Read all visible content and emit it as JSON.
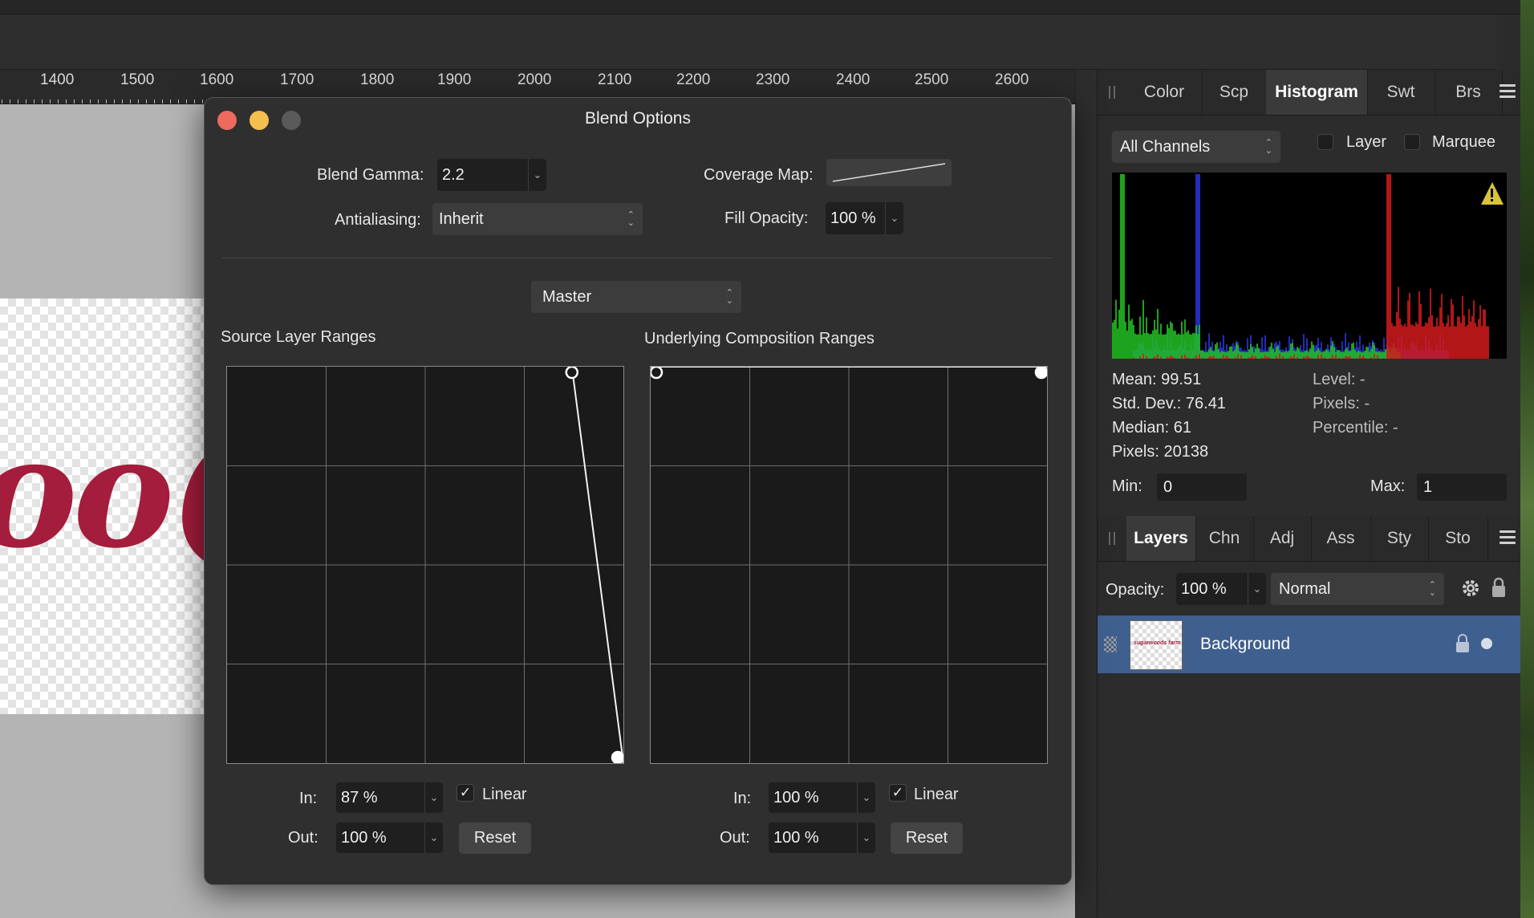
{
  "ruler": {
    "labels": [
      "1400",
      "1500",
      "1600",
      "1700",
      "1800",
      "1900",
      "2000",
      "2100",
      "2200",
      "2300",
      "2400",
      "2500",
      "2600"
    ]
  },
  "canvas": {
    "doc_text": "oo("
  },
  "dialog": {
    "title": "Blend Options",
    "blend_gamma_label": "Blend Gamma:",
    "blend_gamma_value": "2.2",
    "coverage_map_label": "Coverage Map:",
    "antialiasing_label": "Antialiasing:",
    "antialiasing_value": "Inherit",
    "fill_opacity_label": "Fill Opacity:",
    "fill_opacity_value": "100 %",
    "channel_value": "Master",
    "source": {
      "title": "Source Layer Ranges",
      "in_label": "In:",
      "in_value": "87 %",
      "out_label": "Out:",
      "out_value": "100 %",
      "linear_label": "Linear",
      "linear_checked": true,
      "reset_label": "Reset",
      "curve_points": [
        [
          0.87,
          1.0
        ],
        [
          1.0,
          0.0
        ]
      ]
    },
    "underlying": {
      "title": "Underlying Composition Ranges",
      "in_label": "In:",
      "in_value": "100 %",
      "out_label": "Out:",
      "out_value": "100 %",
      "linear_label": "Linear",
      "linear_checked": true,
      "reset_label": "Reset",
      "curve_points": [
        [
          0.0,
          1.0
        ],
        [
          1.0,
          1.0
        ]
      ]
    }
  },
  "top_panel": {
    "tabs": [
      "Color",
      "Scp",
      "Histogram",
      "Swt",
      "Brs"
    ],
    "active_tab": "Histogram",
    "channel_value": "All Channels",
    "layer_label": "Layer",
    "marquee_label": "Marquee",
    "stats": {
      "mean": "Mean: 99.51",
      "std_dev": "Std. Dev.: 76.41",
      "median": "Median: 61",
      "pixels": "Pixels: 20138",
      "level": "Level: -",
      "pixels_sel": "Pixels: -",
      "percentile": "Percentile: -"
    },
    "min_label": "Min:",
    "min_value": "0",
    "max_label": "Max:",
    "max_value": "1"
  },
  "bottom_panel": {
    "tabs": [
      "Layers",
      "Chn",
      "Adj",
      "Ass",
      "Sty",
      "Sto"
    ],
    "active_tab": "Layers",
    "opacity_label": "Opacity:",
    "opacity_value": "100 %",
    "blend_mode": "Normal",
    "layers": [
      {
        "name": "Background",
        "thumb_text": "sugarwoods farm"
      }
    ]
  },
  "colors": {
    "close": "#ed6a5e",
    "minimize": "#f5bf4f",
    "zoom": "#5a5a5a",
    "selection": "#3f5f8f",
    "brand": "#a41d3c"
  }
}
